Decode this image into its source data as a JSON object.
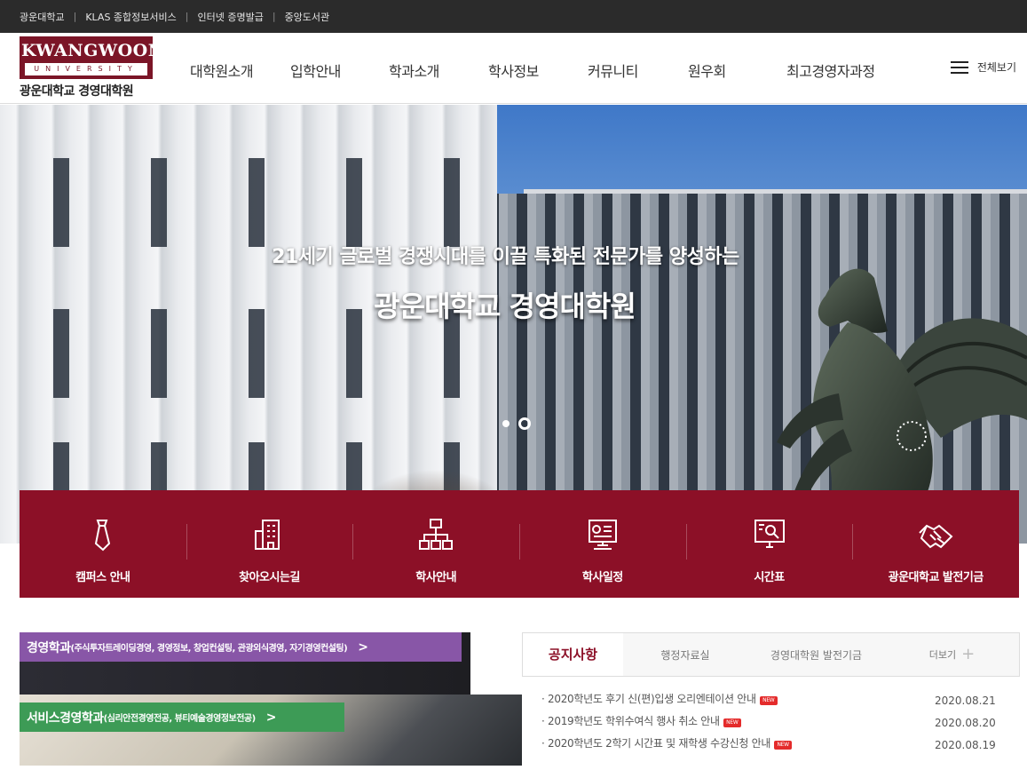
{
  "utilbar": {
    "links": [
      "광운대학교",
      "KLAS 종합정보서비스",
      "인터넷 증명발급",
      "중앙도서관"
    ],
    "separator": "|"
  },
  "header": {
    "logo_main": "KWANGWOON",
    "logo_sub": "UNIVERSITY",
    "logo_caption": "광운대학교 경영대학원",
    "nav": [
      "대학원소개",
      "입학안내",
      "학과소개",
      "학사정보",
      "커뮤니티",
      "원우회",
      "최고경영자과정"
    ],
    "all_menu": "전체보기"
  },
  "hero": {
    "line1": "21세기 글로벌 경쟁시대를 이끌 특화된 전문가를 양성하는",
    "line2": "광운대학교 경영대학원"
  },
  "quick_links": [
    {
      "label": "캠퍼스 안내",
      "icon": "tie-icon"
    },
    {
      "label": "찾아오시는길",
      "icon": "building-icon"
    },
    {
      "label": "학사안내",
      "icon": "org-chart-icon"
    },
    {
      "label": "학사일정",
      "icon": "calendar-monitor-icon"
    },
    {
      "label": "시간표",
      "icon": "search-monitor-icon"
    },
    {
      "label": "광운대학교 발전기금",
      "icon": "handshake-icon"
    }
  ],
  "banners": [
    {
      "title": "경영학과",
      "sub": "(주식투자트레이딩경영, 경영정보, 창업컨설팅, 관광외식경영, 자기경영컨설팅)",
      "arrow": ">",
      "color": "#8856a7"
    },
    {
      "title": "서비스경영학과",
      "sub": "(심리안전경영전공, 뷰티예술경영정보전공)",
      "arrow": ">",
      "color": "#3d9b56"
    }
  ],
  "board": {
    "tabs": [
      "공지사항",
      "행정자료실",
      "경영대학원 발전기금"
    ],
    "more": "더보기",
    "new_badge": "NEW",
    "notices": [
      {
        "title": "2020학년도 후기 신(편)입생 오리엔테이션 안내",
        "date": "2020.08.21"
      },
      {
        "title": "2019학년도 학위수여식 행사 취소 안내",
        "date": "2020.08.20"
      },
      {
        "title": "2020학년도 2학기 시간표 및 재학생 수강신청 안내",
        "date": "2020.08.19"
      }
    ]
  },
  "colors": {
    "brand": "#8c1027",
    "utilbar": "#2b2b2b"
  }
}
